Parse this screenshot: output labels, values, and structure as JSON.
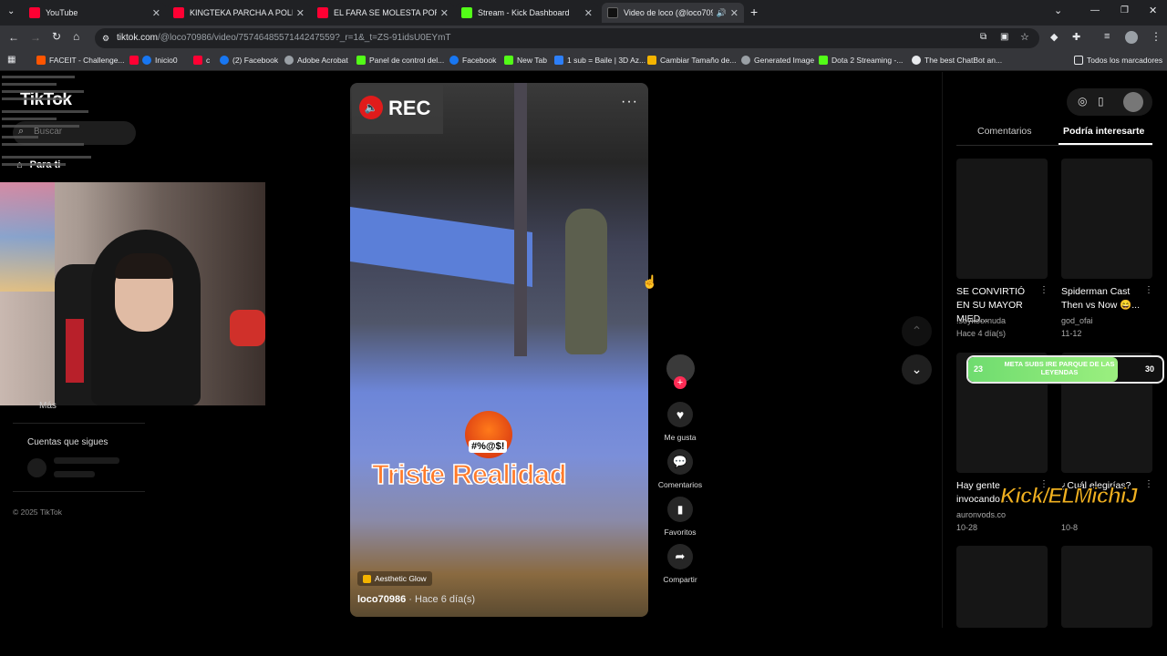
{
  "browser": {
    "tabs": [
      {
        "label": "YouTube",
        "color": "#ff0033"
      },
      {
        "label": "KINGTEKA PARCHA A POLI",
        "color": "#ff0033"
      },
      {
        "label": "EL FARA SE MOLESTA POR",
        "color": "#ff0033"
      },
      {
        "label": "Stream - Kick Dashboard",
        "color": "#53fc18"
      },
      {
        "label": "Video de loco (@loco7098",
        "color": "#000000"
      }
    ],
    "url_main": "tiktok.com",
    "url_rest": "/@loco70986/video/7574648557144247559?_r=1&_t=ZS-91idsU0EYmT",
    "bookmarks": [
      "FACEIT - Challenge...",
      "Inicio0",
      "c",
      "(2) Facebook",
      "Adobe Acrobat",
      "Panel de control del...",
      "Facebook",
      "New Tab",
      "1 sub = Baile | 3D Az...",
      "Cambiar Tamaño de...",
      "Generated Image",
      "Dota 2 Streaming -...",
      "The best ChatBot an..."
    ],
    "all_bookmarks": "Todos los marcadores"
  },
  "tiktok": {
    "logo": "TikTok",
    "search_placeholder": "Buscar",
    "para_ti": "Para ti",
    "mas": "Más",
    "following_title": "Cuentas que sigues",
    "copyright": "© 2025 TikTok",
    "tabs": {
      "comments": "Comentarios",
      "interest": "Podría interesarte"
    }
  },
  "video": {
    "rec": "REC",
    "sticker": "#%@$!",
    "caption": "Triste Realidad",
    "effect": "Aesthetic Glow",
    "author": "loco70986",
    "time": "Hace 6 día(s)"
  },
  "actions": {
    "like": "Me gusta",
    "comments": "Comentarios",
    "favorites": "Favoritos",
    "share": "Compartir"
  },
  "suggestions": [
    {
      "title": "SE CONVIRTIÓ EN SU MAYOR MIED...",
      "author": ".soykoornuda",
      "date": "Hace 4 día(s)"
    },
    {
      "title": "Spiderman Cast Then vs Now 😄...",
      "author": "god_ofai",
      "date": "11-12"
    },
    {
      "title": "Hay gente invocando...",
      "author": "auronvods.co",
      "date": "10-28"
    },
    {
      "title": "¿Cuál elegirías?",
      "author": "",
      "date": "10-8"
    }
  ],
  "overlay": {
    "goal_text": "META SUBS IRE PARQUE DE LAS LEYENDAS",
    "goal_current": "23",
    "goal_target": "30",
    "goal_progress": 0.77,
    "kick_handle": "Kick/ELMichiJ"
  }
}
